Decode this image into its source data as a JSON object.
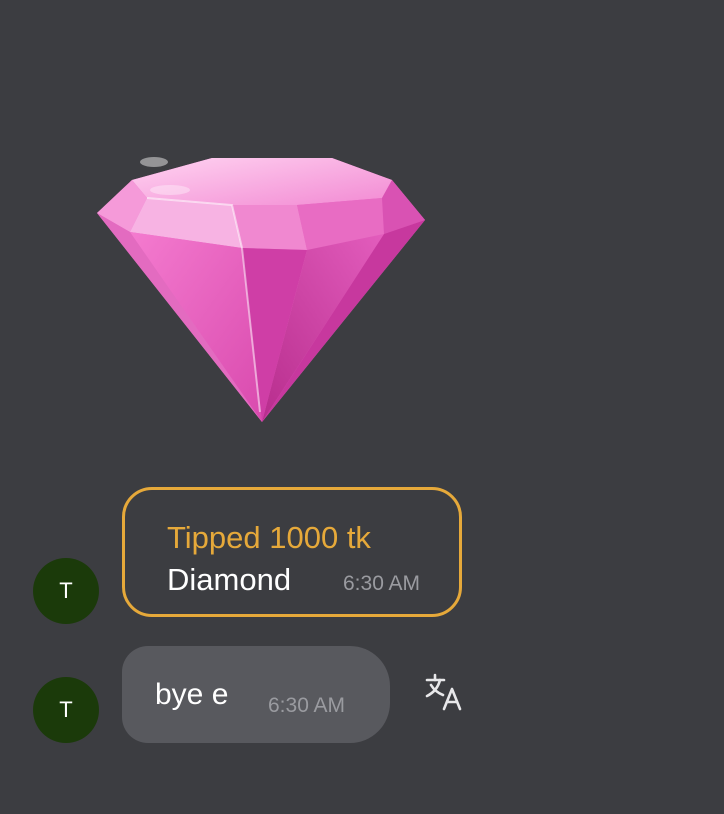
{
  "gift": {
    "icon": "diamond-gift-icon",
    "colors": {
      "light": "#f7a6df",
      "mid": "#e65fc1",
      "dark": "#c43a9a"
    }
  },
  "messages": [
    {
      "avatar_initial": "T",
      "type": "tip",
      "title": "Tipped 1000 tk",
      "gift_name": "Diamond",
      "time": "6:30 AM",
      "border_color": "#e6a93a"
    },
    {
      "avatar_initial": "T",
      "type": "text",
      "text": "bye e",
      "time": "6:30 AM",
      "action_icon": "translate-icon"
    }
  ],
  "colors": {
    "background": "#3c3d41",
    "avatar": "#1b3a0a",
    "bubble": "#58595e",
    "accent": "#e6a93a",
    "timestamp": "#9a9ba0"
  }
}
